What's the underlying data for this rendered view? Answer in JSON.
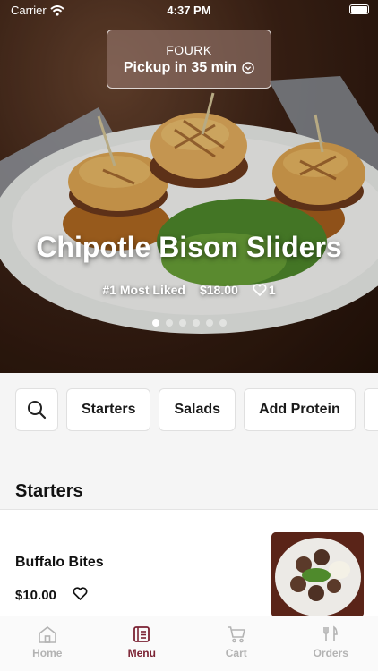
{
  "status_bar": {
    "carrier": "Carrier",
    "time": "4:37 PM"
  },
  "pickup": {
    "restaurant": "FOURK",
    "pickup_text": "Pickup in 35 min"
  },
  "hero": {
    "title": "Chipotle Bison Sliders",
    "badge": "#1 Most Liked",
    "price": "$18.00",
    "likes": "1",
    "carousel_dots": 6,
    "active_dot": 0
  },
  "categories": [
    "Starters",
    "Salads",
    "Add Protein"
  ],
  "section": {
    "title": "Starters",
    "items": [
      {
        "name": "Buffalo Bites",
        "price": "$10.00"
      }
    ]
  },
  "tabs": [
    {
      "label": "Home",
      "icon": "home-icon",
      "active": false
    },
    {
      "label": "Menu",
      "icon": "menu-icon",
      "active": true
    },
    {
      "label": "Cart",
      "icon": "cart-icon",
      "active": false
    },
    {
      "label": "Orders",
      "icon": "orders-icon",
      "active": false
    }
  ],
  "colors": {
    "accent": "#7b2233",
    "inactive_tab": "#b3b3b3"
  }
}
